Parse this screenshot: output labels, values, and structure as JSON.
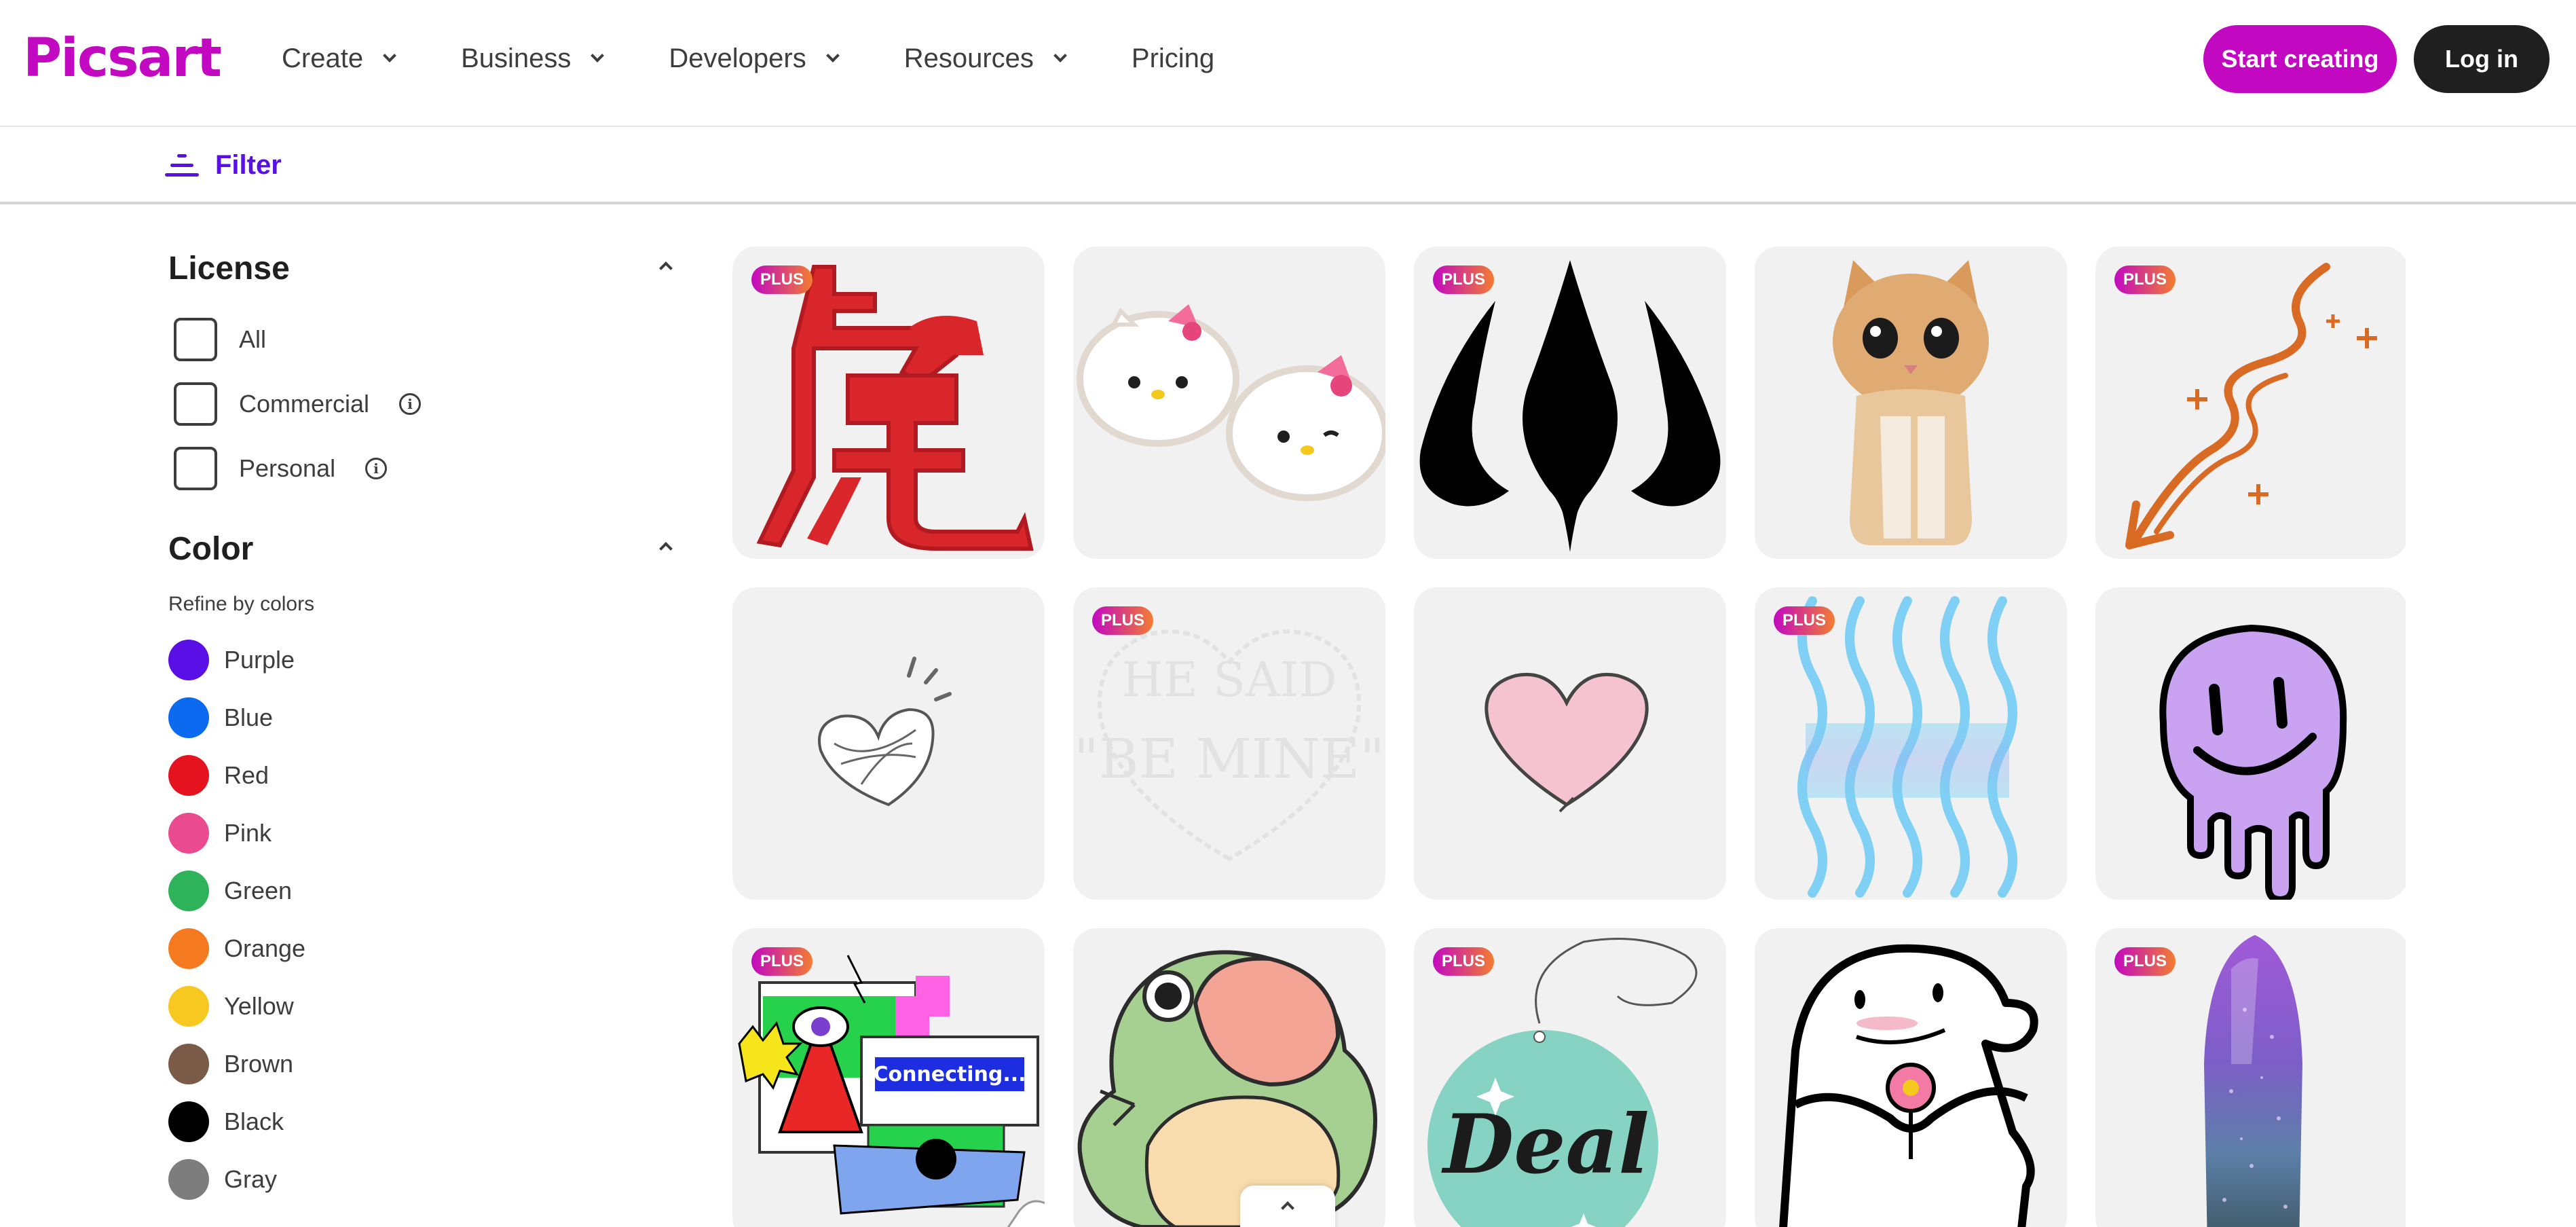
{
  "header": {
    "logo": "Picsart",
    "nav": [
      {
        "label": "Create"
      },
      {
        "label": "Business"
      },
      {
        "label": "Developers"
      },
      {
        "label": "Resources"
      },
      {
        "label": "Pricing"
      }
    ],
    "start_label": "Start creating",
    "login_label": "Log in",
    "brand_color": "#c209c1"
  },
  "filterbar": {
    "label": "Filter",
    "accent": "#5a0fe6"
  },
  "sidebar": {
    "license": {
      "title": "License",
      "options": [
        {
          "label": "All",
          "info": false
        },
        {
          "label": "Commercial",
          "info": true
        },
        {
          "label": "Personal",
          "info": true
        }
      ]
    },
    "color": {
      "title": "Color",
      "subtitle": "Refine by colors",
      "options": [
        {
          "label": "Purple",
          "hex": "#5a0fe6"
        },
        {
          "label": "Blue",
          "hex": "#0b6af0"
        },
        {
          "label": "Red",
          "hex": "#e5121f"
        },
        {
          "label": "Pink",
          "hex": "#ea4b8e"
        },
        {
          "label": "Green",
          "hex": "#2fb35a"
        },
        {
          "label": "Orange",
          "hex": "#f57a1f"
        },
        {
          "label": "Yellow",
          "hex": "#f7c820"
        },
        {
          "label": "Brown",
          "hex": "#7a5b48"
        },
        {
          "label": "Black",
          "hex": "#000000"
        },
        {
          "label": "Gray",
          "hex": "#7d7d7d"
        }
      ]
    }
  },
  "grid": {
    "badge_label": "PLUS",
    "items": [
      {
        "name": "tiger-character-sticker",
        "plus": true
      },
      {
        "name": "hello-kitty-sticker",
        "plus": false
      },
      {
        "name": "black-tribal-spade-sticker",
        "plus": true
      },
      {
        "name": "kitten-sticker",
        "plus": false
      },
      {
        "name": "orange-squiggle-arrow-sticker",
        "plus": true
      },
      {
        "name": "white-scribble-heart-sticker",
        "plus": false
      },
      {
        "name": "he-said-be-mine-sticker",
        "plus": true
      },
      {
        "name": "pink-heart-sticker",
        "plus": false
      },
      {
        "name": "blue-waves-sticker",
        "plus": true
      },
      {
        "name": "purple-melting-smiley-sticker",
        "plus": false
      },
      {
        "name": "connecting-collage-sticker",
        "plus": true,
        "caption": "Connecting..."
      },
      {
        "name": "green-frog-sticker",
        "plus": false
      },
      {
        "name": "deal-tag-sticker",
        "plus": true,
        "caption": "Deal"
      },
      {
        "name": "flork-flower-sticker",
        "plus": false
      },
      {
        "name": "glitter-nail-sticker",
        "plus": true
      }
    ],
    "faded_text_1": "HE SAID",
    "faded_text_2": "\"BE MINE\""
  }
}
